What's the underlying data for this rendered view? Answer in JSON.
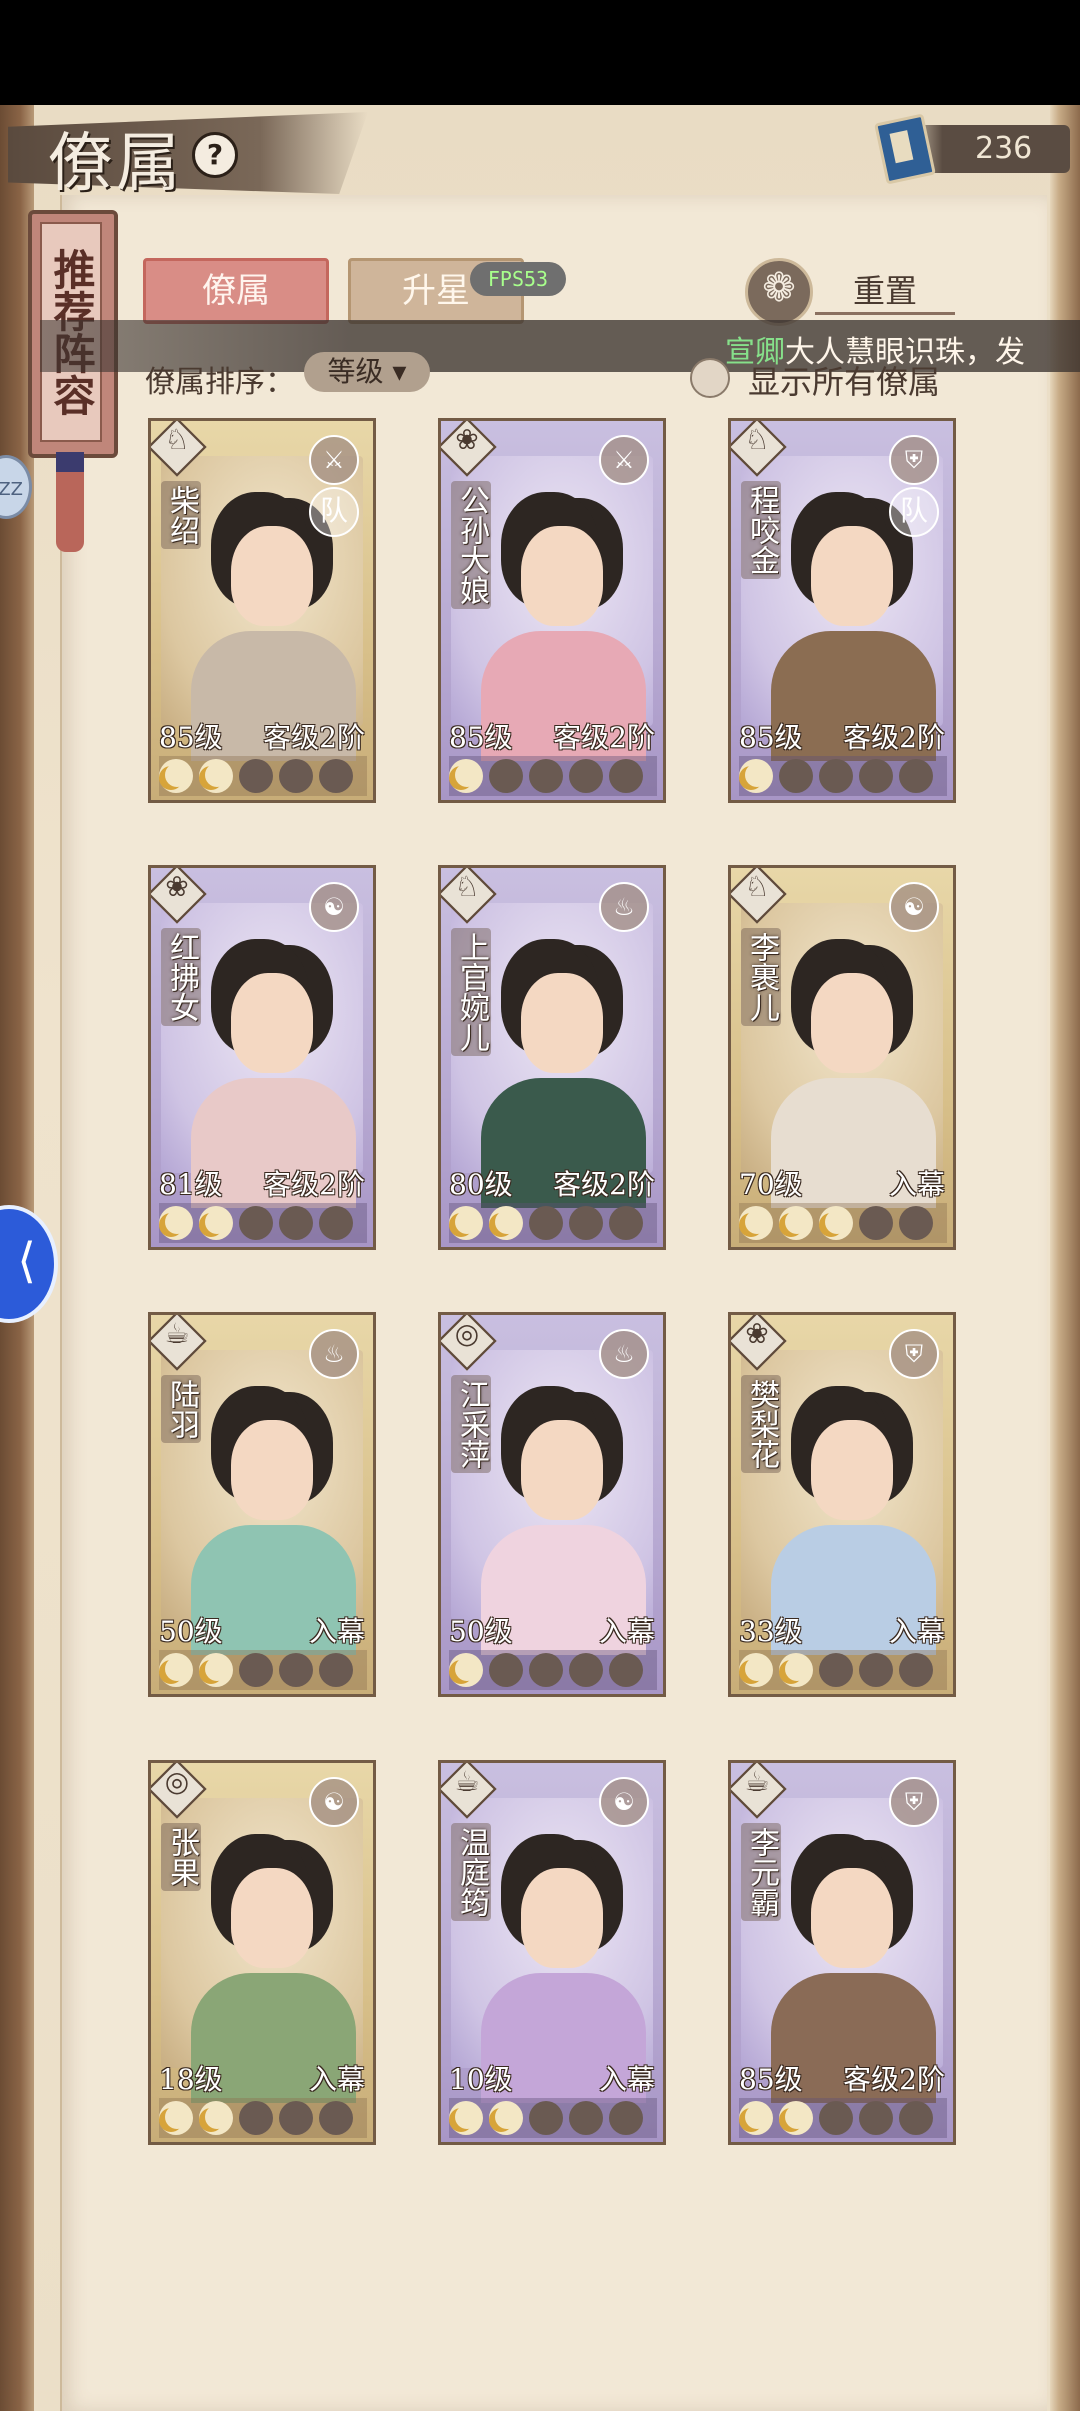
{
  "header": {
    "title": "僚属",
    "help_icon": "question-icon",
    "currency_value": "236",
    "currency_icon": "book-icon"
  },
  "side": {
    "scroll_label": "推荐阵容",
    "bubble_text": "ZZ"
  },
  "tabs": [
    {
      "label": "僚属",
      "active": true
    },
    {
      "label": "升星",
      "active": false
    }
  ],
  "fps_label": "FPS53",
  "reset": {
    "label": "重置",
    "icon": "reset-icon"
  },
  "marquee": {
    "name": "宣卿",
    "text": "大人慧眼识珠，发"
  },
  "sort": {
    "label": "僚属排序：",
    "value": "等级"
  },
  "show_all": {
    "label": "显示所有僚属",
    "checked": false
  },
  "cards": [
    {
      "name": "柴绍",
      "level": "85级",
      "rank": "客级2阶",
      "stars": 2,
      "rarity": "gold",
      "type_icon": "qilin-icon",
      "corner_icon": "sword-icon",
      "badge": "队",
      "body_color": "#c8b9a8"
    },
    {
      "name": "公孙大娘",
      "level": "85级",
      "rank": "客级2阶",
      "stars": 1,
      "rarity": "purple",
      "type_icon": "fan-icon",
      "corner_icon": "sword-icon",
      "badge": "",
      "body_color": "#e7a9b5"
    },
    {
      "name": "程咬金",
      "level": "85级",
      "rank": "客级2阶",
      "stars": 1,
      "rarity": "purple",
      "type_icon": "qilin-icon",
      "corner_icon": "shield-icon",
      "badge": "队",
      "body_color": "#8b6d52"
    },
    {
      "name": "红拂女",
      "level": "81级",
      "rank": "客级2阶",
      "stars": 2,
      "rarity": "purple",
      "type_icon": "fan-icon",
      "corner_icon": "yinyang-icon",
      "badge": "",
      "body_color": "#e8c9c8"
    },
    {
      "name": "上官婉儿",
      "level": "80级",
      "rank": "客级2阶",
      "stars": 2,
      "rarity": "purple",
      "type_icon": "qilin-icon",
      "corner_icon": "cauldron-icon",
      "badge": "",
      "body_color": "#3a5a4c"
    },
    {
      "name": "李裹儿",
      "level": "70级",
      "rank": "入幕",
      "stars": 3,
      "rarity": "gold",
      "type_icon": "qilin-icon",
      "corner_icon": "yinyang-icon",
      "badge": "",
      "body_color": "#e7ddd0"
    },
    {
      "name": "陆羽",
      "level": "50级",
      "rank": "入幕",
      "stars": 2,
      "rarity": "gold",
      "type_icon": "teapot-icon",
      "corner_icon": "cauldron-icon",
      "badge": "",
      "body_color": "#8fc4b2"
    },
    {
      "name": "江采萍",
      "level": "50级",
      "rank": "入幕",
      "stars": 1,
      "rarity": "purple",
      "type_icon": "gourd-icon",
      "corner_icon": "cauldron-icon",
      "badge": "",
      "body_color": "#efd3df"
    },
    {
      "name": "樊梨花",
      "level": "33级",
      "rank": "入幕",
      "stars": 2,
      "rarity": "gold",
      "type_icon": "fan-icon",
      "corner_icon": "shield-icon",
      "badge": "",
      "body_color": "#b9cde4"
    },
    {
      "name": "张果",
      "level": "18级",
      "rank": "入幕",
      "stars": 2,
      "rarity": "gold",
      "type_icon": "gourd-icon",
      "corner_icon": "yinyang-icon",
      "badge": "",
      "body_color": "#8aa676"
    },
    {
      "name": "温庭筠",
      "level": "10级",
      "rank": "入幕",
      "stars": 2,
      "rarity": "purple",
      "type_icon": "teapot-icon",
      "corner_icon": "yinyang-icon",
      "badge": "",
      "body_color": "#c4a6d8"
    },
    {
      "name": "李元霸",
      "level": "85级",
      "rank": "客级2阶",
      "stars": 2,
      "rarity": "purple",
      "type_icon": "teapot-icon",
      "corner_icon": "shield-icon",
      "badge": "",
      "body_color": "#8a6b56"
    }
  ]
}
